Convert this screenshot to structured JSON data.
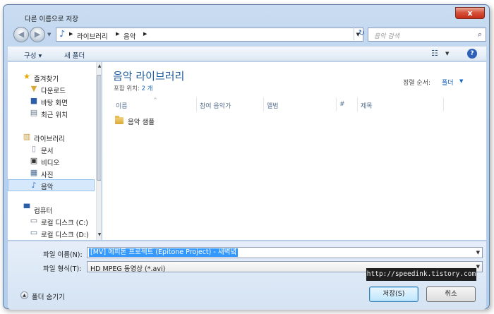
{
  "window": {
    "title": "다른 이름으로 저장",
    "close_label": "x"
  },
  "navigation": {
    "back_icon": "back-arrow-icon",
    "forward_icon": "forward-arrow-icon",
    "breadcrumb": [
      "라이브러리",
      "음악"
    ],
    "refresh_icon": "refresh-icon",
    "search_placeholder": "음악 검색"
  },
  "command_bar": {
    "organize": "구성 ▾",
    "new_folder": "새 폴더",
    "help": "?"
  },
  "nav_pane": {
    "items": [
      {
        "label": "즐겨찾기",
        "icon": "star-icon"
      },
      {
        "label": "다운로드",
        "icon": "downloads-folder-icon"
      },
      {
        "label": "바탕 화면",
        "icon": "desktop-icon"
      },
      {
        "label": "최근 위치",
        "icon": "recent-places-icon"
      },
      {
        "label": "라이브러리",
        "icon": "libraries-icon"
      },
      {
        "label": "문서",
        "icon": "documents-icon"
      },
      {
        "label": "비디오",
        "icon": "videos-icon"
      },
      {
        "label": "사진",
        "icon": "pictures-icon"
      },
      {
        "label": "음악",
        "icon": "music-icon",
        "selected": true
      },
      {
        "label": "컴퓨터",
        "icon": "computer-icon"
      },
      {
        "label": "로컬 디스크 (C:)",
        "icon": "windows-drive-icon"
      },
      {
        "label": "로컬 디스크 (D:)",
        "icon": "drive-icon"
      }
    ]
  },
  "main": {
    "library_title": "음악 라이브러리",
    "includes_label": "포함 위치:",
    "includes_value": "2 개",
    "sort_label": "정렬 순서:",
    "sort_value": "폴더",
    "columns": [
      "이름",
      "참여 음악가",
      "앨범",
      "#",
      "제목"
    ],
    "items": [
      {
        "name": "음악 샘플",
        "icon": "folder-icon"
      }
    ]
  },
  "bottom": {
    "filename_label": "파일 이름(N):",
    "filename_label_key": "N",
    "filename_value": "[MV] 에피톤 프로젝트 (Epitone Project) - 새벽녘",
    "filetype_label": "파일 형식(T):",
    "filetype_label_key": "T",
    "filetype_value": "HD MPEG 동영상 (*.avi)",
    "watermark": "http://speedink.tistory.com",
    "hide_folders": "폴더 숨기기",
    "save_button": "저장(S)",
    "cancel_button": "취소"
  }
}
